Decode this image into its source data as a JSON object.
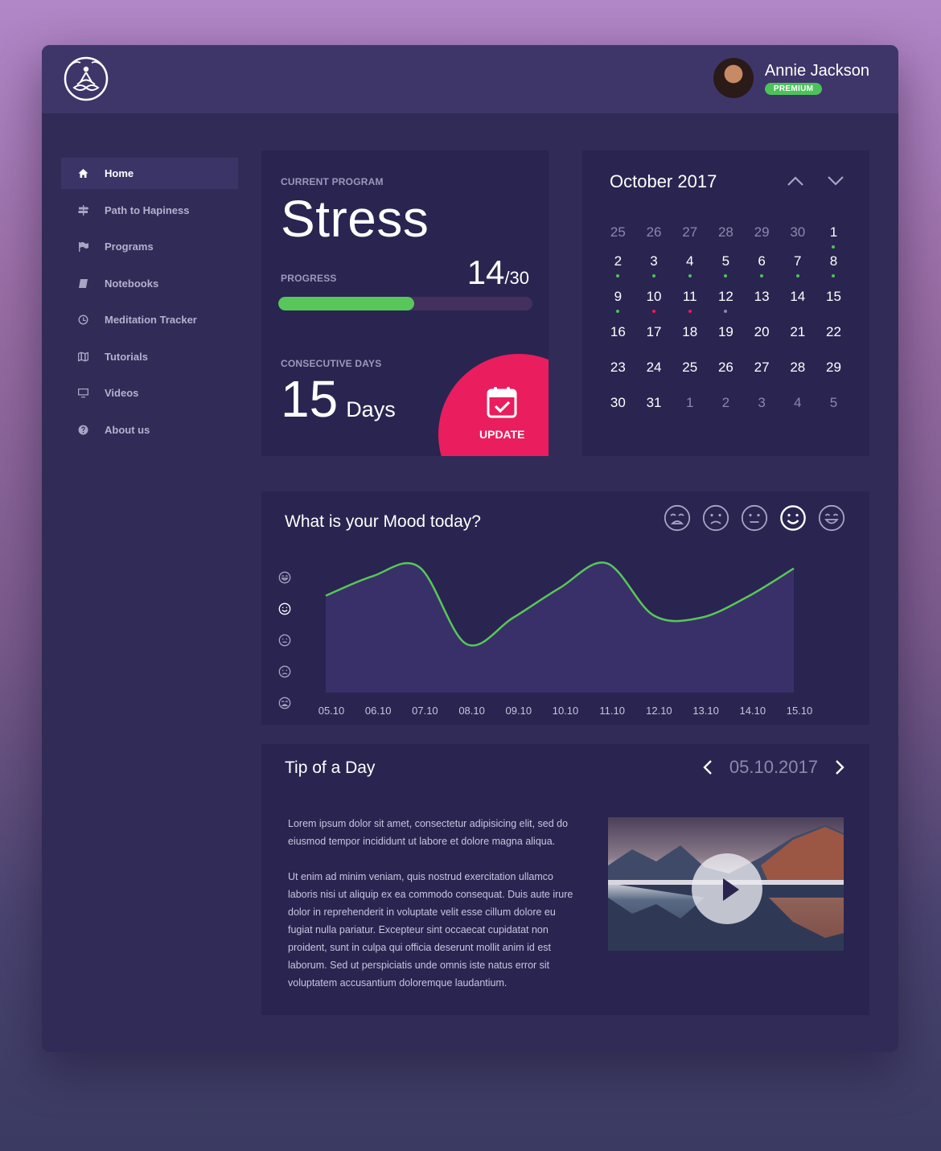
{
  "user": {
    "name": "Annie Jackson",
    "badge": "PREMIUM"
  },
  "nav": [
    {
      "label": "Home",
      "icon": "home-icon",
      "active": true
    },
    {
      "label": "Path to Hapiness",
      "icon": "signpost-icon"
    },
    {
      "label": "Programs",
      "icon": "flag-icon"
    },
    {
      "label": "Notebooks",
      "icon": "notebook-icon"
    },
    {
      "label": "Meditation Tracker",
      "icon": "clock-icon"
    },
    {
      "label": "Tutorials",
      "icon": "map-icon"
    },
    {
      "label": "Videos",
      "icon": "monitor-icon"
    },
    {
      "label": "About us",
      "icon": "help-icon"
    }
  ],
  "program": {
    "label": "CURRENT PROGRAM",
    "name": "Stress",
    "progress_label": "PROGRESS",
    "progress_current": "14",
    "progress_total": "/30",
    "progress_fraction": 0.5333,
    "consecutive_label": "CONSECUTIVE DAYS",
    "days_value": "15",
    "days_unit": "Days",
    "update_label": "UPDATE"
  },
  "calendar": {
    "month": "October 2017",
    "weeks": [
      [
        [
          "25",
          "m"
        ],
        [
          "26",
          "m"
        ],
        [
          "27",
          "m"
        ],
        [
          "28",
          "m"
        ],
        [
          "29",
          "m"
        ],
        [
          "30",
          "m"
        ],
        [
          "1",
          "g"
        ]
      ],
      [
        [
          "2",
          "g"
        ],
        [
          "3",
          "g"
        ],
        [
          "4",
          "g"
        ],
        [
          "5",
          "g"
        ],
        [
          "6",
          "g"
        ],
        [
          "7",
          "g"
        ],
        [
          "8",
          "g"
        ]
      ],
      [
        [
          "9",
          "g"
        ],
        [
          "10",
          "r"
        ],
        [
          "11",
          "r"
        ],
        [
          "12",
          "x"
        ],
        [
          "13",
          ""
        ],
        [
          "14",
          ""
        ],
        [
          "15",
          ""
        ]
      ],
      [
        [
          "16",
          ""
        ],
        [
          "17",
          ""
        ],
        [
          "18",
          ""
        ],
        [
          "19",
          ""
        ],
        [
          "20",
          ""
        ],
        [
          "21",
          ""
        ],
        [
          "22",
          ""
        ]
      ],
      [
        [
          "23",
          ""
        ],
        [
          "24",
          ""
        ],
        [
          "25",
          ""
        ],
        [
          "26",
          ""
        ],
        [
          "27",
          ""
        ],
        [
          "28",
          ""
        ],
        [
          "29",
          ""
        ]
      ],
      [
        [
          "30",
          ""
        ],
        [
          "31",
          ""
        ],
        [
          "1",
          "m"
        ],
        [
          "2",
          "m"
        ],
        [
          "3",
          "m"
        ],
        [
          "4",
          "m"
        ],
        [
          "5",
          "m"
        ]
      ]
    ],
    "dot_colors": {
      "g": "#4cc25a",
      "r": "#ea1d5e",
      "x": "#8d88ac"
    }
  },
  "mood": {
    "title": "What is your Mood today?",
    "faces": [
      "crying-face-icon",
      "sad-face-icon",
      "neutral-face-icon",
      "smile-face-icon",
      "grin-face-icon"
    ],
    "selected_face": 3
  },
  "chart_data": {
    "type": "area",
    "x": [
      "05.10",
      "06.10",
      "07.10",
      "08.10",
      "09.10",
      "10.10",
      "11.10",
      "12.10",
      "13.10",
      "14.10",
      "15.10"
    ],
    "series": [
      {
        "values": [
          2.95,
          3.7,
          4.05,
          1.1,
          2.1,
          3.25,
          4.2,
          2.2,
          2.1,
          2.9,
          4.0
        ]
      }
    ],
    "ylim": [
      0,
      4.3
    ],
    "y_icons": [
      "grin-face-icon",
      "smile-face-icon",
      "neutral-face-icon",
      "sad-face-icon",
      "crying-face-icon"
    ],
    "line_color": "#57c75a",
    "fill_color": "#3a3069"
  },
  "tip": {
    "title": "Tip of a Day",
    "date": "05.10.2017",
    "paragraphs": [
      "Lorem ipsum dolor sit amet, consectetur adipisicing elit, sed do eiusmod tempor incididunt ut labore et dolore magna aliqua.",
      "Ut enim ad minim veniam, quis nostrud exercitation ullamco laboris nisi ut aliquip ex ea commodo consequat. Duis aute irure dolor in reprehenderit in voluptate velit esse cillum dolore eu fugiat nulla pariatur. Excepteur sint occaecat cupidatat non proident, sunt in culpa qui officia deserunt mollit anim id est laborum. Sed ut perspiciatis unde omnis iste natus error sit voluptatem accusantium doloremque laudantium."
    ]
  }
}
